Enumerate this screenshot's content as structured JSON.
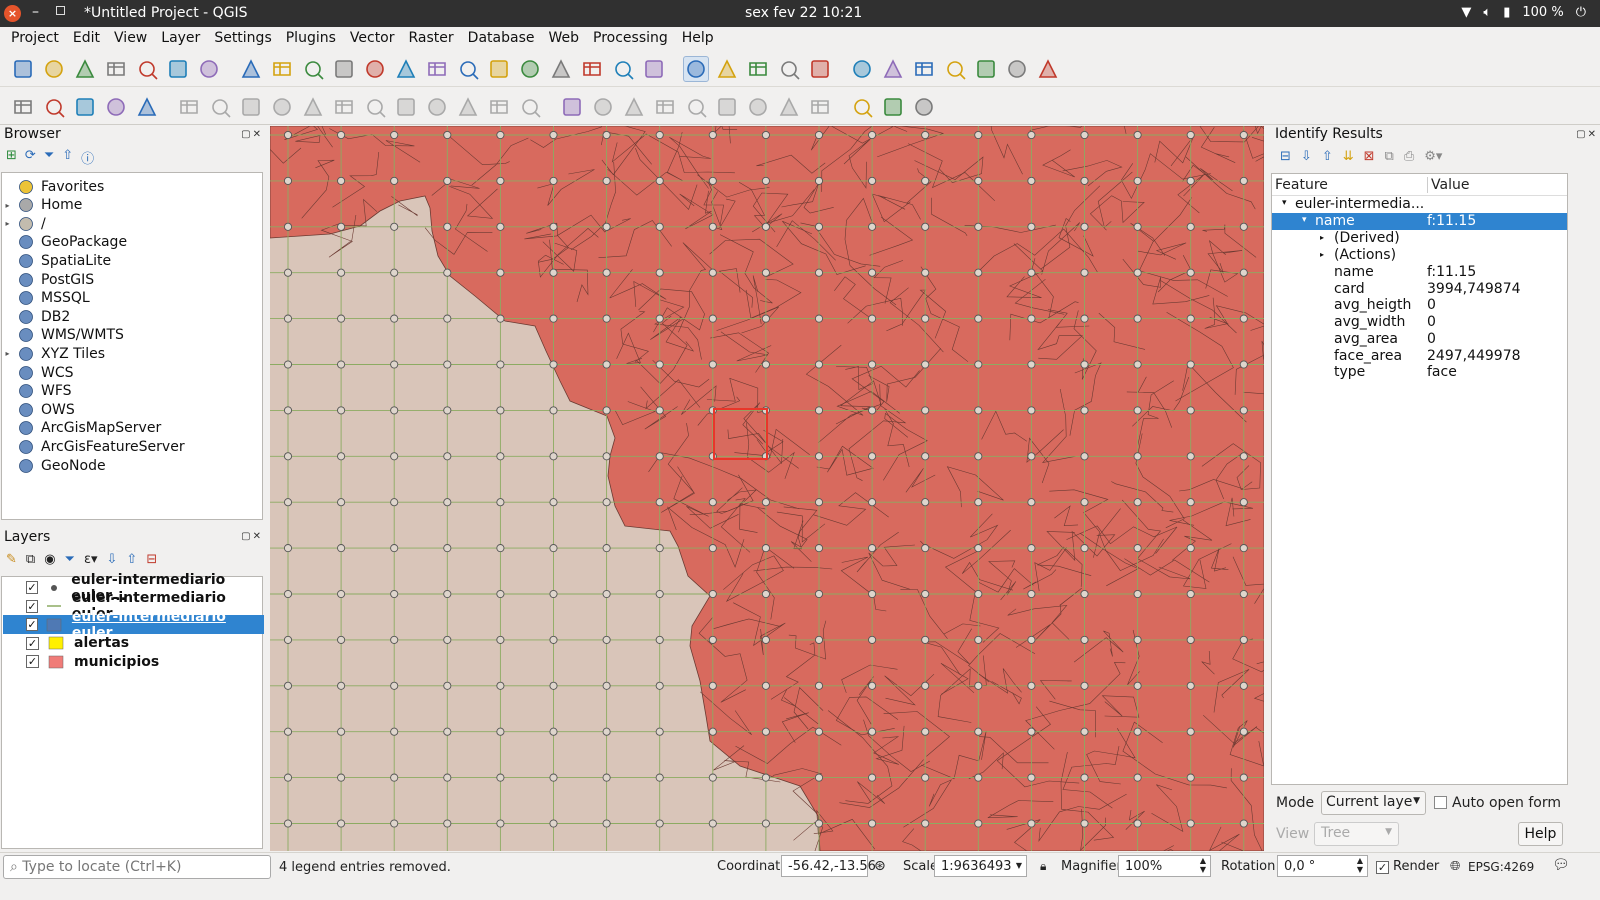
{
  "window": {
    "title": "*Untitled Project - QGIS",
    "clock": "sex fev 22  10:21",
    "battery": "100 %"
  },
  "menu": [
    "Project",
    "Edit",
    "View",
    "Layer",
    "Settings",
    "Plugins",
    "Vector",
    "Raster",
    "Database",
    "Web",
    "Processing",
    "Help"
  ],
  "toolbar1_icons": [
    "new-project-icon",
    "open-project-icon",
    "save-project-icon",
    "save-as-icon",
    "new-print-layout-icon",
    "layout-manager-icon",
    "style-manager-icon",
    "pan-icon",
    "pan-to-selection-icon",
    "zoom-in-icon",
    "zoom-out-icon",
    "zoom-native-icon",
    "zoom-full-icon",
    "zoom-to-selection-icon",
    "zoom-to-layer-icon",
    "zoom-last-icon",
    "zoom-next-icon",
    "new-map-view-icon",
    "new-bookmark-icon",
    "show-bookmarks-icon",
    "refresh-icon",
    "identify-icon",
    "map-tips-icon",
    "select-features-icon",
    "select-by-value-icon",
    "deselect-icon",
    "attribute-table-icon",
    "field-calculator-icon",
    "processing-toolbox-icon",
    "statistics-icon",
    "measure-icon",
    "map-tip-icon",
    "text-annotation-icon"
  ],
  "toolbar2_icons": [
    "data-source-manager-icon",
    "new-geopackage-icon",
    "new-shapefile-icon",
    "digitize-icon",
    "georeferencer-icon",
    "current-edits-icon",
    "toggle-editing-icon",
    "save-edits-icon",
    "add-feature-icon",
    "vertex-tool-icon",
    "modify-attributes-icon",
    "delete-selected-icon",
    "cut-features-icon",
    "copy-features-icon",
    "paste-features-icon",
    "undo-icon",
    "redo-icon",
    "label-icon",
    "diagram-icon",
    "highlight-pinned-labels-icon",
    "pin-label-icon",
    "show-hide-labels-icon",
    "move-label-icon",
    "rotate-label-icon",
    "change-label-icon",
    "label-settings-icon",
    "globe-icon",
    "python-console-icon",
    "whats-this-icon"
  ],
  "browser": {
    "title": "Browser",
    "items": [
      {
        "label": "Favorites",
        "icon": "star-icon",
        "expandable": false
      },
      {
        "label": "Home",
        "icon": "home-folder-icon",
        "expandable": true
      },
      {
        "label": "/",
        "icon": "folder-icon",
        "expandable": true
      },
      {
        "label": "GeoPackage",
        "icon": "geopackage-icon",
        "expandable": false
      },
      {
        "label": "SpatiaLite",
        "icon": "spatialite-icon",
        "expandable": false
      },
      {
        "label": "PostGIS",
        "icon": "postgis-icon",
        "expandable": false
      },
      {
        "label": "MSSQL",
        "icon": "mssql-icon",
        "expandable": false
      },
      {
        "label": "DB2",
        "icon": "db2-icon",
        "expandable": false
      },
      {
        "label": "WMS/WMTS",
        "icon": "wms-icon",
        "expandable": false
      },
      {
        "label": "XYZ Tiles",
        "icon": "xyz-tiles-icon",
        "expandable": true
      },
      {
        "label": "WCS",
        "icon": "wcs-icon",
        "expandable": false
      },
      {
        "label": "WFS",
        "icon": "wfs-icon",
        "expandable": false
      },
      {
        "label": "OWS",
        "icon": "ows-icon",
        "expandable": false
      },
      {
        "label": "ArcGisMapServer",
        "icon": "arcgis-map-icon",
        "expandable": false
      },
      {
        "label": "ArcGisFeatureServer",
        "icon": "arcgis-feature-icon",
        "expandable": false
      },
      {
        "label": "GeoNode",
        "icon": "geonode-icon",
        "expandable": false
      }
    ]
  },
  "layers": {
    "title": "Layers",
    "items": [
      {
        "label": "euler-intermediario euler...",
        "symbol": "point",
        "checked": true,
        "selected": false
      },
      {
        "label": "euler-intermediario euler...",
        "symbol": "line",
        "checked": true,
        "selected": false
      },
      {
        "label": "euler-intermediario euler...",
        "symbol": "polygon-blue",
        "checked": true,
        "selected": true
      },
      {
        "label": "alertas",
        "symbol": "polygon-yellow",
        "checked": true,
        "selected": false
      },
      {
        "label": "municipios",
        "symbol": "polygon-salmon",
        "checked": true,
        "selected": false
      }
    ]
  },
  "identify": {
    "title": "Identify Results",
    "headers": {
      "feature": "Feature",
      "value": "Value"
    },
    "layer_name": "euler-intermedia...",
    "selected_row": {
      "key": "name",
      "value": "f:11.15"
    },
    "groups": [
      "(Derived)",
      "(Actions)"
    ],
    "attributes": [
      {
        "key": "name",
        "value": "f:11.15"
      },
      {
        "key": "card",
        "value": "3994,749874"
      },
      {
        "key": "avg_heigth",
        "value": "0"
      },
      {
        "key": "avg_width",
        "value": "0"
      },
      {
        "key": "avg_area",
        "value": "0"
      },
      {
        "key": "face_area",
        "value": "2497,449978"
      },
      {
        "key": "type",
        "value": "face"
      }
    ],
    "mode_label": "Mode",
    "mode_value": "Current laye",
    "auto_open_label": "Auto open form",
    "view_label": "View",
    "view_value": "Tree",
    "help_label": "Help"
  },
  "status": {
    "locator_placeholder": "Type to locate (Ctrl+K)",
    "message": "4 legend entries removed.",
    "coordinate_label": "Coordinate",
    "coordinate_value": "-56.42,-13.56",
    "scale_label": "Scale",
    "scale_value": "1:9636493",
    "magnifier_label": "Magnifier",
    "magnifier_value": "100%",
    "rotation_label": "Rotation",
    "rotation_value": "0,0 °",
    "render_label": "Render",
    "crs": "EPSG:4269"
  },
  "colors": {
    "polygon_fill": "#d86a5e",
    "background_land": "#d9c5b9",
    "grid_line": "#8cab62",
    "selection": "#2f84d0",
    "highlight": "#e8362a"
  }
}
